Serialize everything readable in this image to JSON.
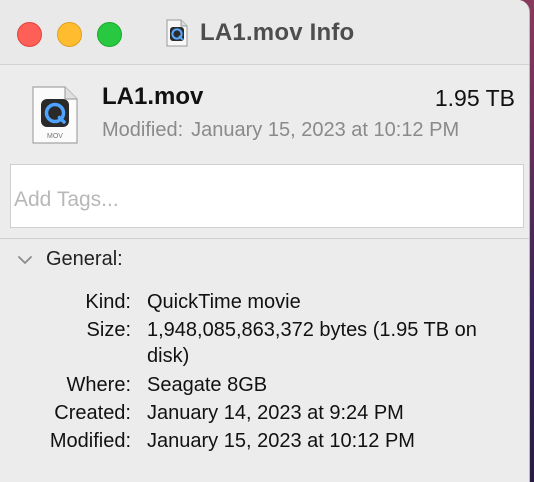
{
  "window": {
    "title": "LA1.mov Info"
  },
  "file": {
    "name": "LA1.mov",
    "size": "1.95 TB",
    "modified_label": "Modified:",
    "modified_value": "January 15, 2023 at 10:12 PM",
    "icon_badge": "MOV"
  },
  "tags": {
    "placeholder": "Add Tags..."
  },
  "general": {
    "title": "General:",
    "rows": [
      {
        "label": "Kind:",
        "value": "QuickTime movie"
      },
      {
        "label": "Size:",
        "value": "1,948,085,863,372 bytes (1.95 TB on disk)"
      },
      {
        "label": "Where:",
        "value": "Seagate 8GB"
      },
      {
        "label": "Created:",
        "value": "January 14, 2023 at 9:24 PM"
      },
      {
        "label": "Modified:",
        "value": "January 15, 2023 at 10:12 PM"
      }
    ]
  },
  "colors": {
    "close": "#fe5f57",
    "minimize": "#febc2e",
    "zoom": "#28c840",
    "quicktime_blue": "#1d6fd8"
  }
}
